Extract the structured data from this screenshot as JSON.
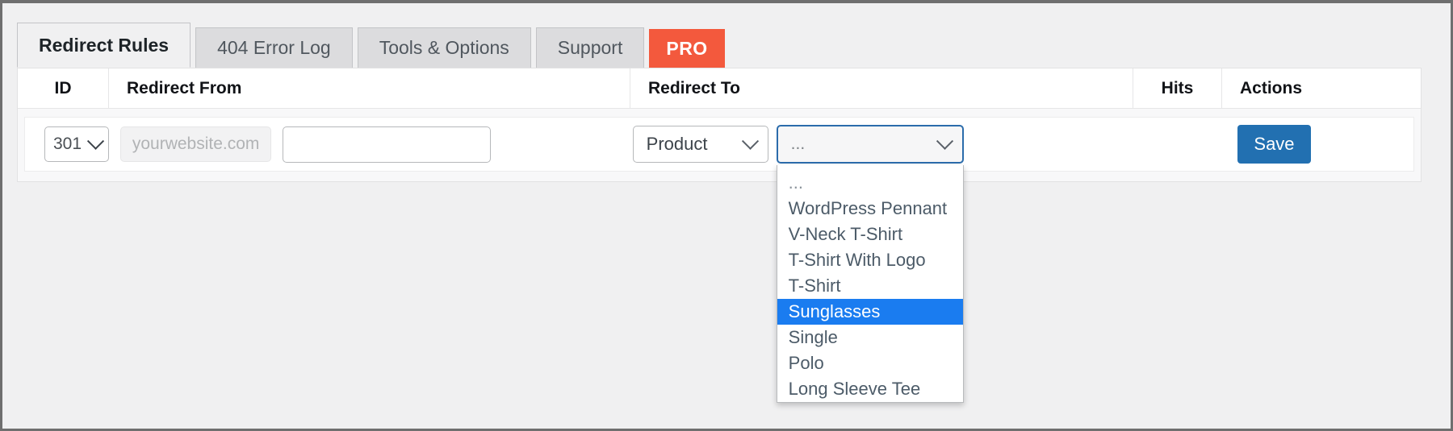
{
  "tabs": [
    {
      "label": "Redirect Rules",
      "state": "active"
    },
    {
      "label": "404 Error Log",
      "state": "inactive"
    },
    {
      "label": "Tools & Options",
      "state": "inactive"
    },
    {
      "label": "Support",
      "state": "inactive"
    },
    {
      "label": "PRO",
      "state": "pro"
    }
  ],
  "table": {
    "headers": {
      "id": "ID",
      "redirect_from": "Redirect From",
      "redirect_to": "Redirect To",
      "hits": "Hits",
      "actions": "Actions"
    }
  },
  "row": {
    "status_code": "301",
    "url_prefix": "yourwebsite.com",
    "from_path_value": "",
    "from_path_placeholder": "",
    "target_type": "Product",
    "target_value": "...",
    "hits": "",
    "save_label": "Save"
  },
  "dropdown": {
    "open": true,
    "selected": "Sunglasses",
    "options": [
      "...",
      "WordPress Pennant",
      "V-Neck T-Shirt",
      "T-Shirt With Logo",
      "T-Shirt",
      "Sunglasses",
      "Single",
      "Polo",
      "Long Sleeve Tee"
    ]
  },
  "colors": {
    "pro_tab": "#f3593d",
    "save_button": "#2270b1",
    "highlight": "#1a7cf0",
    "focus_border": "#2b6cab",
    "page_background": "#f0f0f1"
  },
  "icons": {
    "chevron": "chevron-down-icon"
  }
}
